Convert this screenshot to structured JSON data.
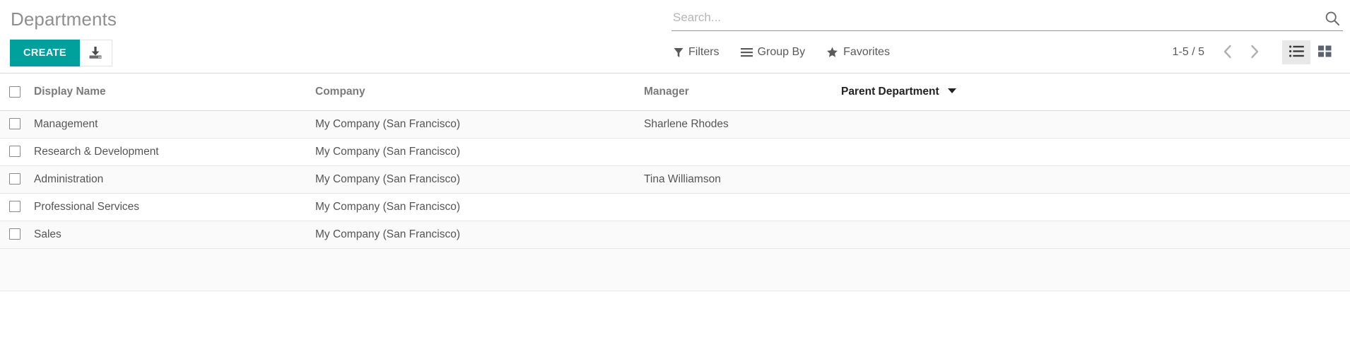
{
  "header": {
    "title": "Departments",
    "create_label": "CREATE",
    "import_icon": "import-download-icon"
  },
  "search": {
    "placeholder": "Search...",
    "value": "",
    "icon": "search-icon"
  },
  "filter_bar": {
    "items": [
      {
        "label": "Filters",
        "icon": "filter-funnel-icon"
      },
      {
        "label": "Group By",
        "icon": "bars-icon"
      },
      {
        "label": "Favorites",
        "icon": "star-icon"
      }
    ]
  },
  "pager": {
    "range": "1-5 / 5",
    "previous_icon": "chevron-left-icon",
    "next_icon": "chevron-right-icon"
  },
  "view_switcher": {
    "views": [
      {
        "name": "list",
        "icon": "list-view-icon",
        "active": true
      },
      {
        "name": "kanban",
        "icon": "kanban-grid-icon",
        "active": false
      }
    ]
  },
  "table": {
    "select_all": false,
    "columns": [
      {
        "key": "display_name",
        "label": "Display Name",
        "sorted": false
      },
      {
        "key": "company",
        "label": "Company",
        "sorted": false
      },
      {
        "key": "manager",
        "label": "Manager",
        "sorted": false
      },
      {
        "key": "parent_department",
        "label": "Parent Department",
        "sorted": true,
        "sort_dir": "desc"
      }
    ],
    "rows": [
      {
        "display_name": "Management",
        "company": "My Company (San Francisco)",
        "manager": "Sharlene Rhodes",
        "parent_department": "",
        "selected": false
      },
      {
        "display_name": "Research & Development",
        "company": "My Company (San Francisco)",
        "manager": "",
        "parent_department": "",
        "selected": false
      },
      {
        "display_name": "Administration",
        "company": "My Company (San Francisco)",
        "manager": "Tina Williamson",
        "parent_department": "",
        "selected": false
      },
      {
        "display_name": "Professional Services",
        "company": "My Company (San Francisco)",
        "manager": "",
        "parent_department": "",
        "selected": false
      },
      {
        "display_name": "Sales",
        "company": "My Company (San Francisco)",
        "manager": "",
        "parent_department": "",
        "selected": false
      }
    ]
  },
  "colors": {
    "accent": "#00a09d",
    "title_grey": "#8f8f8f",
    "text": "#555555",
    "border": "#e6e6e6",
    "row_alt": "#fafafa",
    "active_view_bg": "#e8e8e8"
  }
}
